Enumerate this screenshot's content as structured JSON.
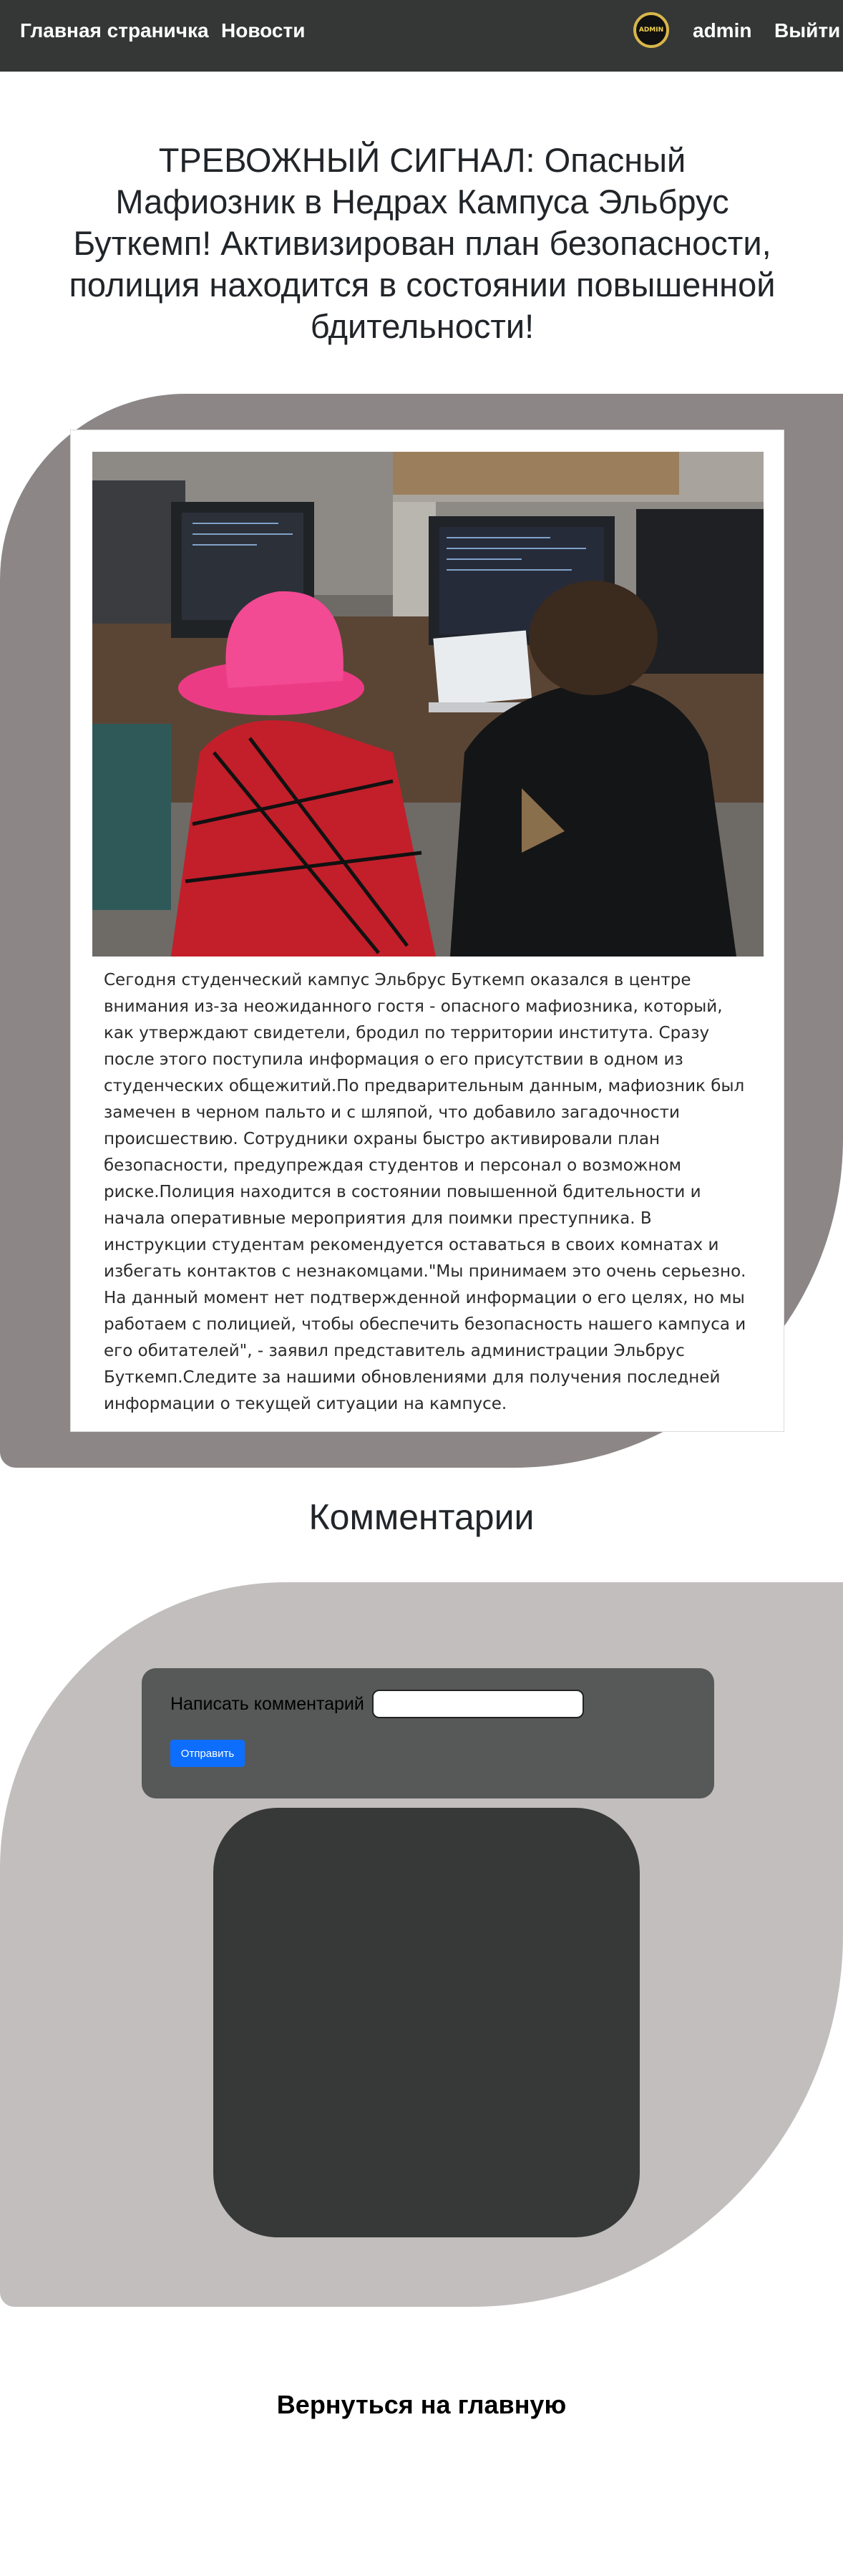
{
  "nav": {
    "home": "Главная страничка",
    "news": "Новости",
    "avatar_text": "ADMIN",
    "username": "admin",
    "logout": "Выйти"
  },
  "article": {
    "title": "ТРЕВОЖНЫЙ СИГНАЛ: Опасный Мафиозник в Недрах Кампуса Эльбрус Буткемп! Активизирован план безопасности, полиция находится в состоянии повышенной бдительности!",
    "body": "Сегодня студенческий кампус Эльбрус Буткемп оказался в центре внимания из-за неожиданного гостя - опасного мафиозника, который, как утверждают свидетели, бродил по территории института. Сразу после этого поступила информация о его присутствии в одном из студенческих общежитий.По предварительным данным, мафиозник был замечен в черном пальто и с шляпой, что добавило загадочности происшествию. Сотрудники охраны быстро активировали план безопасности, предупреждая студентов и персонал о возможном риске.Полиция находится в состоянии повышенной бдительности и начала оперативные мероприятия для поимки преступника. В инструкции студентам рекомендуется оставаться в своих комнатах и избегать контактов с незнакомцами.\"Мы принимаем это очень серьезно. На данный момент нет подтвержденной информации о его целях, но мы работаем с полицией, чтобы обеспечить безопасность нашего кампуса и его обитателей\", - заявил представитель администрации Эльбрус Буткемп.Следите за нашими обновлениями для получения последней информации о текущей ситуации на кампусе."
  },
  "comments": {
    "title": "Комментарии",
    "label": "Написать комментарий",
    "input_value": "",
    "submit": "Отправить"
  },
  "footer": {
    "back": "Вернуться на главную"
  },
  "colors": {
    "navbar": "#353736",
    "blob_dark": "#8c8687",
    "blob_light": "#c2bebd",
    "form_box": "#575959",
    "comments_panel": "#373938",
    "button": "#0d6efd"
  }
}
